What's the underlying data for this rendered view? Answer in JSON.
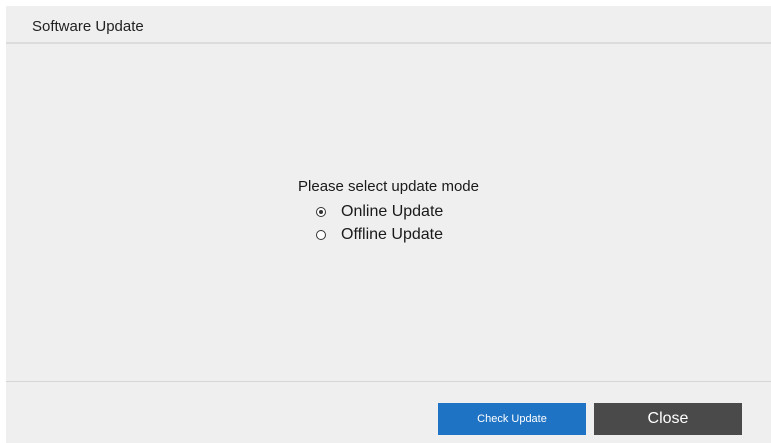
{
  "dialog": {
    "title": "Software Update"
  },
  "update_mode": {
    "prompt": "Please select update mode",
    "options": [
      {
        "label": "Online Update",
        "selected": true
      },
      {
        "label": "Offline Update",
        "selected": false
      }
    ]
  },
  "footer": {
    "check_update_label": "Check Update",
    "close_label": "Close"
  },
  "colors": {
    "dialog_background": "#efefef",
    "primary_button": "#1f73c4",
    "secondary_button": "#4a4a4a"
  }
}
